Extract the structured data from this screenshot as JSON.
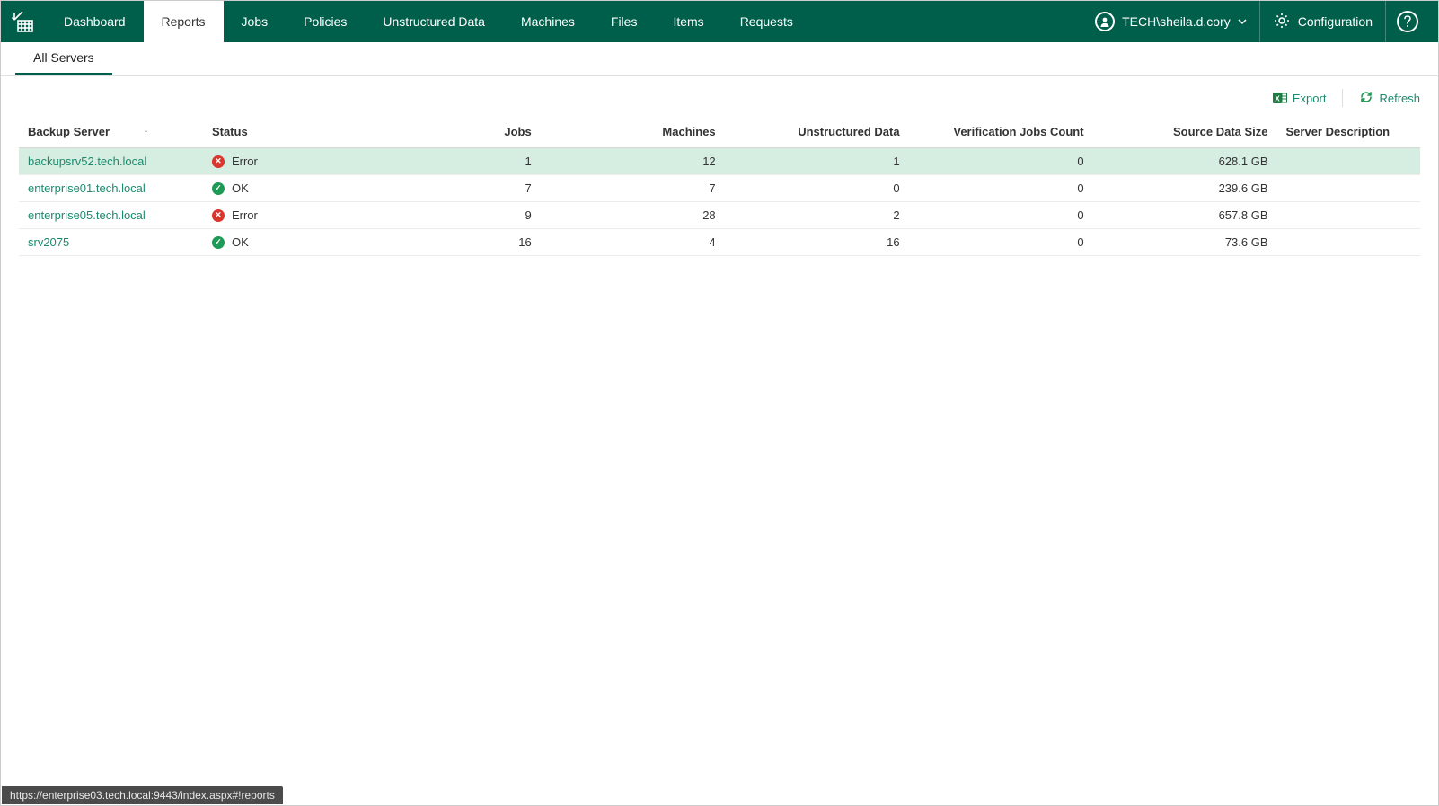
{
  "nav": {
    "items": [
      {
        "label": "Dashboard"
      },
      {
        "label": "Reports",
        "active": true
      },
      {
        "label": "Jobs"
      },
      {
        "label": "Policies"
      },
      {
        "label": "Unstructured Data"
      },
      {
        "label": "Machines"
      },
      {
        "label": "Files"
      },
      {
        "label": "Items"
      },
      {
        "label": "Requests"
      }
    ],
    "user_label": "TECH\\sheila.d.cory",
    "config_label": "Configuration"
  },
  "subtabs": {
    "items": [
      {
        "label": "All Servers",
        "active": true
      }
    ]
  },
  "toolbar": {
    "export_label": "Export",
    "refresh_label": "Refresh"
  },
  "table": {
    "columns": {
      "backup_server": "Backup Server",
      "status": "Status",
      "jobs": "Jobs",
      "machines": "Machines",
      "unstructured": "Unstructured Data",
      "verification": "Verification Jobs Count",
      "source_size": "Source Data Size",
      "description": "Server Description"
    },
    "sort_indicator": "↑",
    "rows": [
      {
        "server": "backupsrv52.tech.local",
        "status": "Error",
        "status_kind": "err",
        "jobs": "1",
        "machines": "12",
        "unstructured": "1",
        "verification": "0",
        "source_size": "628.1 GB",
        "description": "",
        "selected": true
      },
      {
        "server": "enterprise01.tech.local",
        "status": "OK",
        "status_kind": "ok",
        "jobs": "7",
        "machines": "7",
        "unstructured": "0",
        "verification": "0",
        "source_size": "239.6 GB",
        "description": ""
      },
      {
        "server": "enterprise05.tech.local",
        "status": "Error",
        "status_kind": "err",
        "jobs": "9",
        "machines": "28",
        "unstructured": "2",
        "verification": "0",
        "source_size": "657.8 GB",
        "description": ""
      },
      {
        "server": "srv2075",
        "status": "OK",
        "status_kind": "ok",
        "jobs": "16",
        "machines": "4",
        "unstructured": "16",
        "verification": "0",
        "source_size": "73.6 GB",
        "description": ""
      }
    ]
  },
  "status_bar": {
    "url": "https://enterprise03.tech.local:9443/index.aspx#!reports"
  }
}
